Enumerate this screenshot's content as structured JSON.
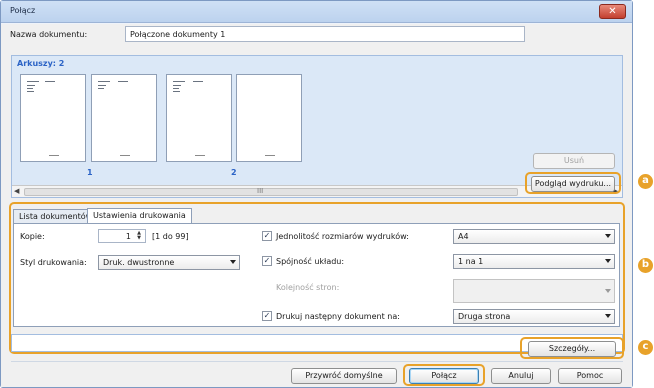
{
  "window": {
    "title": "Połącz",
    "close_glyph": "✕"
  },
  "document_name": {
    "label": "Nazwa dokumentu:",
    "value": "Połączone dokumenty 1"
  },
  "sheets": {
    "label": "Arkuszy: 2",
    "page_numbers": [
      "1",
      "2"
    ],
    "grip": "III"
  },
  "buttons": {
    "remove": "Usuń",
    "print_preview": "Podgląd wydruku...",
    "details": "Szczegóły...",
    "restore_defaults": "Przywróć domyślne",
    "combine": "Połącz",
    "cancel": "Anuluj",
    "help": "Pomoc"
  },
  "tabs": [
    {
      "label": "Lista dokumentów",
      "active": false
    },
    {
      "label": "Ustawienia drukowania",
      "active": true
    }
  ],
  "print_settings": {
    "copies_label": "Kopie:",
    "copies_value": "1",
    "copies_range": "[1 do 99]",
    "print_style_label": "Styl drukowania:",
    "print_style_value": "Druk. dwustronne",
    "uniform_size_label": "Jednolitość rozmiarów wydruków:",
    "uniform_size_checked": true,
    "uniform_size_value": "A4",
    "layout_consistency_label": "Spójność układu:",
    "layout_consistency_checked": true,
    "layout_consistency_value": "1 na 1",
    "page_order_label": "Kolejność stron:",
    "page_order_value": "",
    "print_next_label": "Drukuj następny dokument na:",
    "print_next_checked": true,
    "print_next_value": "Druga strona"
  },
  "callouts": [
    "a",
    "b",
    "c"
  ],
  "colors": {
    "callout": "#e8a22a",
    "sheets_label": "#2b63c6",
    "close_button": "#c3402f"
  }
}
